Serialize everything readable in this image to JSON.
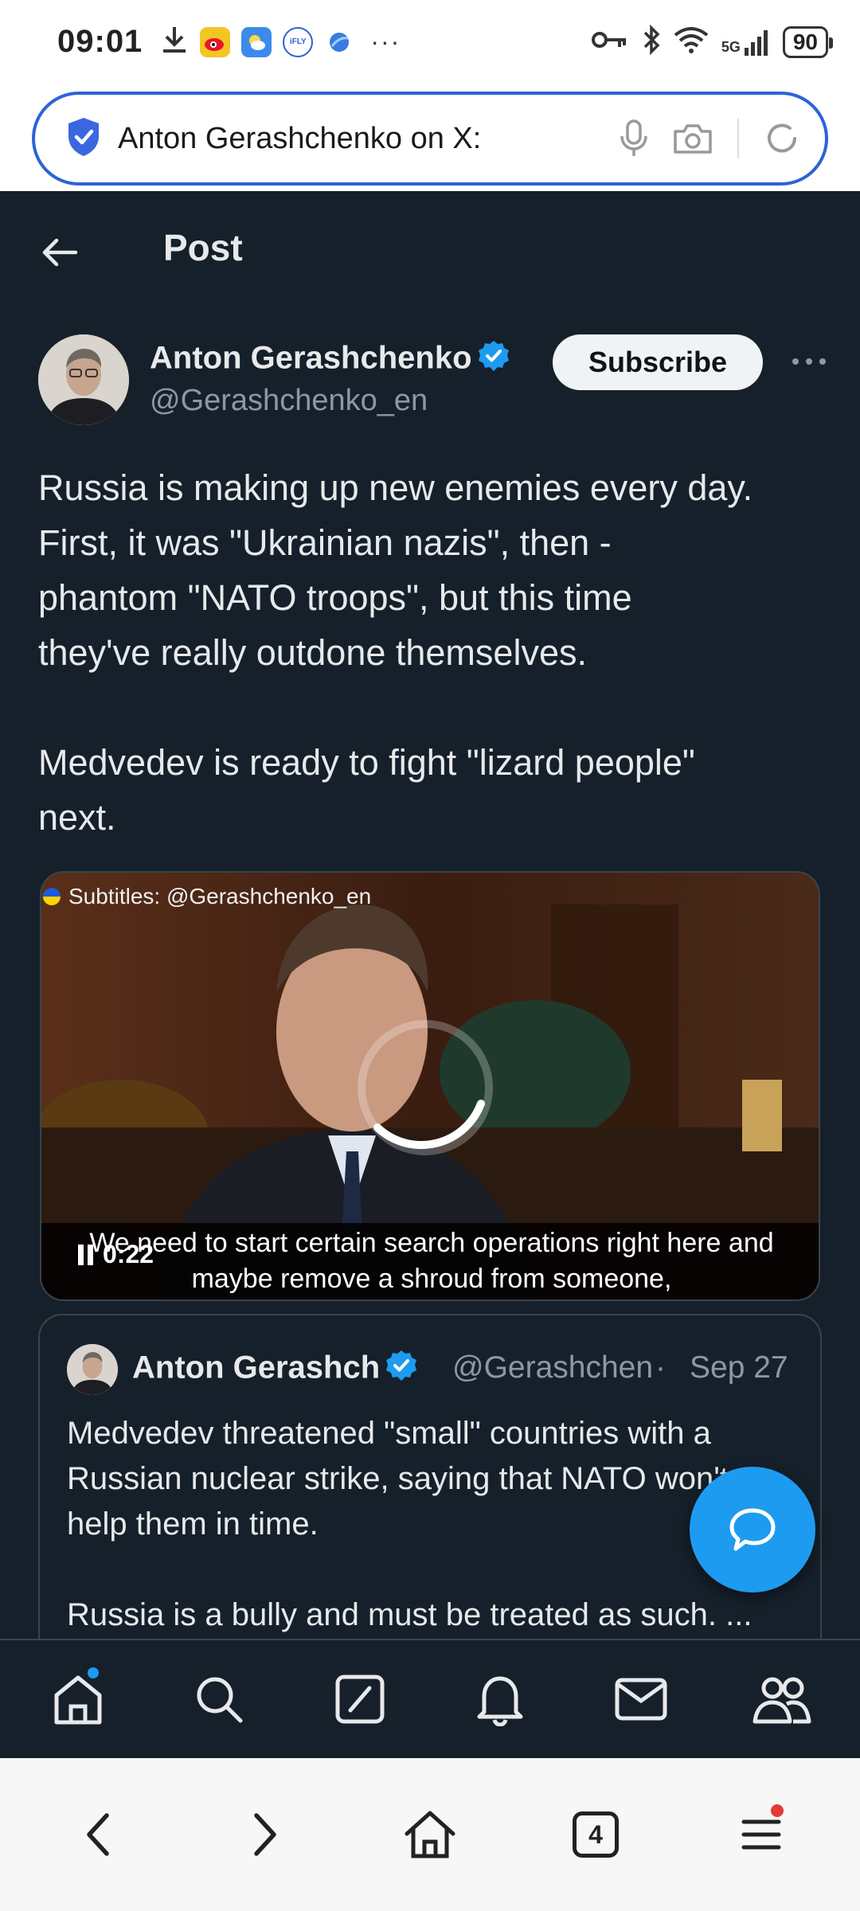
{
  "status_bar": {
    "time": "09:01",
    "network": "5G",
    "battery": "90"
  },
  "browser": {
    "url_title": "Anton Gerashchenko on X:",
    "tab_count": "4"
  },
  "header": {
    "title": "Post"
  },
  "post": {
    "author_name": "Anton Gerashchenko",
    "author_handle": "@Gerashchenko_en",
    "subscribe_label": "Subscribe",
    "text_lines": [
      "Russia is making up new enemies every day.",
      "First, it was \"Ukrainian nazis\", then -",
      "phantom \"NATO troops\", but this time",
      "they've really outdone themselves."
    ],
    "text_line2": "Medvedev is ready to fight \"lizard people\"",
    "text_line3": "next."
  },
  "video": {
    "subtitle_tag": "Subtitles: @Gerashchenko_en",
    "caption_line1": "We need to start certain search operations right here and",
    "caption_line2": "maybe remove a shroud from someone,",
    "time": "0:22"
  },
  "quote": {
    "author_name": "Anton Gerashch",
    "author_handle": "@Gerashchen",
    "separator": "·",
    "date": "Sep 27",
    "text_a1": "Medvedev threatened \"small\" countries with a",
    "text_a2": "Russian nuclear strike, saying that NATO won't",
    "text_a3": "help them in time.",
    "text_b": "Russia is a bully and must be treated as such. ..."
  },
  "colors": {
    "app_background": "#15202b",
    "accent": "#1d9bf0",
    "url_border": "#2d63d8",
    "text_primary": "#e7e9ea",
    "text_secondary": "#8b98a5"
  },
  "icons": {
    "bottom_nav": [
      "home-icon",
      "search-icon",
      "grok-icon",
      "notifications-icon",
      "messages-icon",
      "communities-icon"
    ],
    "browser_bar": [
      "back-icon",
      "forward-icon",
      "home-icon",
      "tabs-icon",
      "menu-icon"
    ]
  }
}
